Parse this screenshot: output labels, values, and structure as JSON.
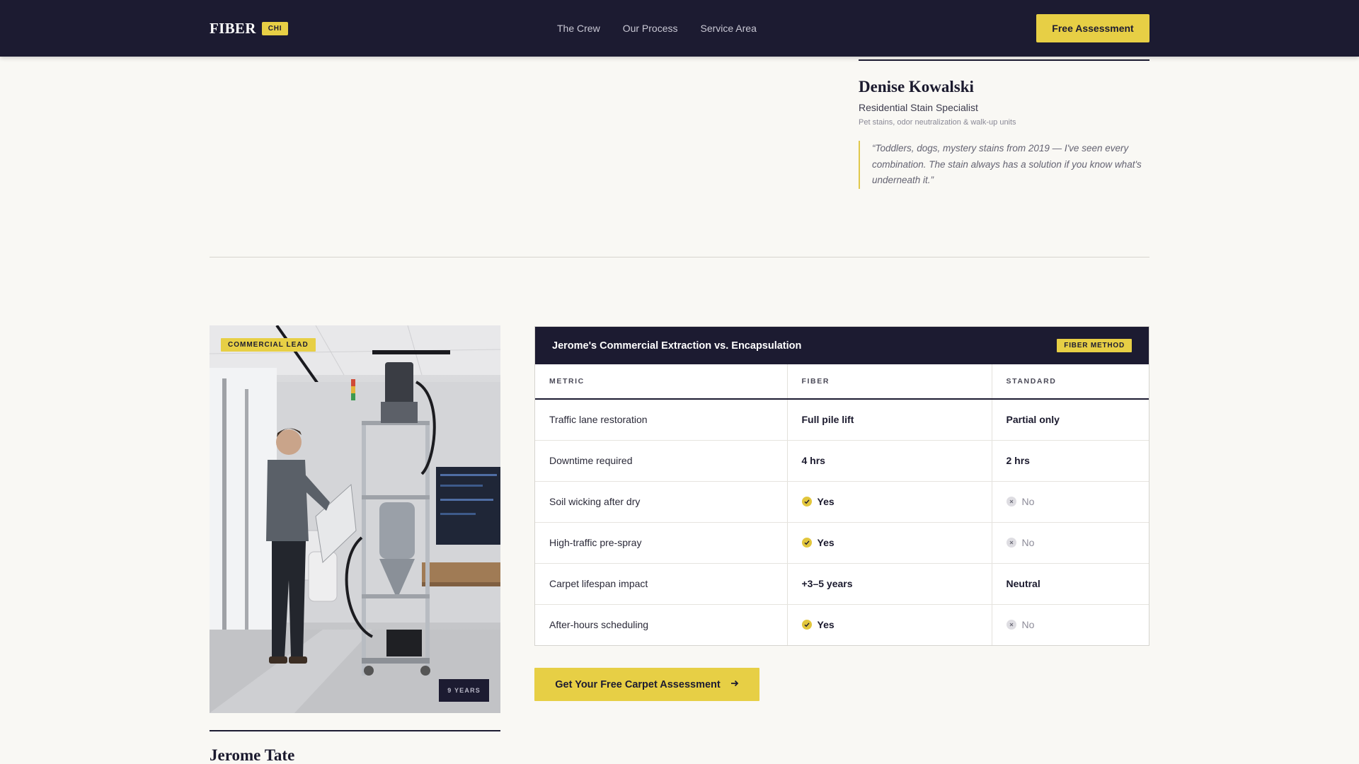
{
  "header": {
    "brand": "FIBER",
    "brand_badge": "CHI",
    "nav": [
      "The Crew",
      "Our Process",
      "Service Area"
    ],
    "cta_label": "Free Assessment"
  },
  "denise": {
    "name": "Denise Kowalski",
    "role": "Residential Stain Specialist",
    "specialty": "Pet stains, odor neutralization & walk-up units",
    "quote": "“Toddlers, dogs, mystery stains from 2019 — I've seen every combination. The stain always has a solution if you know what's underneath it.”"
  },
  "jerome": {
    "tag": "COMMERCIAL LEAD",
    "years": "9 YEARS",
    "name": "Jerome Tate"
  },
  "compare": {
    "title": "Jerome's Commercial Extraction vs. Encapsulation",
    "badge": "FIBER METHOD",
    "columns": [
      "METRIC",
      "FIBER",
      "STANDARD"
    ],
    "rows": [
      {
        "metric": "Traffic lane restoration",
        "fiber": "Full pile lift",
        "standard": "Partial only"
      },
      {
        "metric": "Downtime required",
        "fiber": "4 hrs",
        "standard": "2 hrs"
      },
      {
        "metric": "Soil wicking after dry",
        "fiber": "Yes",
        "standard": "No"
      },
      {
        "metric": "High-traffic pre-spray",
        "fiber": "Yes",
        "standard": "No"
      },
      {
        "metric": "Carpet lifespan impact",
        "fiber": "+3–5 years",
        "standard": "Neutral"
      },
      {
        "metric": "After-hours scheduling",
        "fiber": "Yes",
        "standard": "No"
      }
    ]
  },
  "cta": {
    "label": "Get Your Free Carpet Assessment"
  },
  "colors": {
    "navy": "#1c1b31",
    "accent": "#e7cf45",
    "background": "#f9f8f4"
  }
}
